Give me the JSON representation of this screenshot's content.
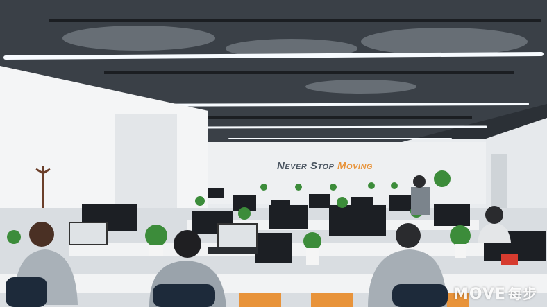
{
  "scene": {
    "slogan": {
      "part1": "Never Stop ",
      "part2": "Moving"
    },
    "watermark": {
      "brand": "MOVE",
      "chinese": "每步"
    },
    "colors": {
      "ceiling": "#2b3036",
      "wall": "#eef0f2",
      "floor": "#d9dde1",
      "accent_orange": "#e8933a",
      "plant_green": "#3c8c3a",
      "desk_white": "#f2f3f4",
      "monitor_black": "#1c1f24"
    }
  }
}
